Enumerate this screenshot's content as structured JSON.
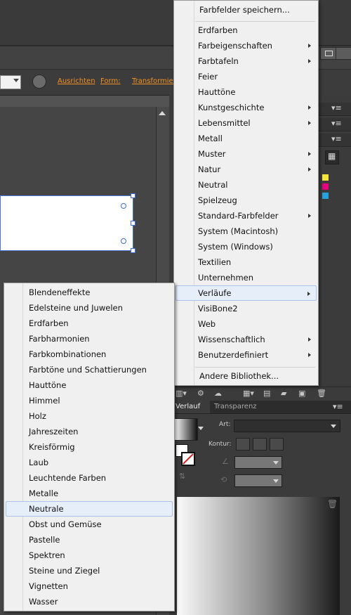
{
  "controlbar": {
    "links": [
      "Ausrichten",
      "Form:",
      "Transformieren"
    ]
  },
  "panel": {
    "tabs": {
      "active": "Verlauf",
      "other": "Transparenz"
    },
    "art_label": "Art:",
    "kontur_label": "Kontur:",
    "swatch_colors": [
      "#f5e53a",
      "#e6007e",
      "#28a0dc"
    ]
  },
  "main_menu": {
    "header_item": "Farbfelder speichern...",
    "items": [
      {
        "label": "Erdfarben",
        "submenu": false
      },
      {
        "label": "Farbeigenschaften",
        "submenu": true
      },
      {
        "label": "Farbtafeln",
        "submenu": true
      },
      {
        "label": "Feier",
        "submenu": false
      },
      {
        "label": "Hauttöne",
        "submenu": false
      },
      {
        "label": "Kunstgeschichte",
        "submenu": true
      },
      {
        "label": "Lebensmittel",
        "submenu": true
      },
      {
        "label": "Metall",
        "submenu": false
      },
      {
        "label": "Muster",
        "submenu": true
      },
      {
        "label": "Natur",
        "submenu": true
      },
      {
        "label": "Neutral",
        "submenu": false
      },
      {
        "label": "Spielzeug",
        "submenu": false
      },
      {
        "label": "Standard-Farbfelder",
        "submenu": true
      },
      {
        "label": "System (Macintosh)",
        "submenu": false
      },
      {
        "label": "System (Windows)",
        "submenu": false
      },
      {
        "label": "Textilien",
        "submenu": false
      },
      {
        "label": "Unternehmen",
        "submenu": false
      },
      {
        "label": "Verläufe",
        "submenu": true,
        "highlighted": true
      },
      {
        "label": "VisiBone2",
        "submenu": false
      },
      {
        "label": "Web",
        "submenu": false
      },
      {
        "label": "Wissenschaftlich",
        "submenu": true
      },
      {
        "label": "Benutzerdefiniert",
        "submenu": true
      }
    ],
    "footer_item": "Andere Bibliothek..."
  },
  "sub_menu": {
    "items": [
      "Blendeneffekte",
      "Edelsteine und Juwelen",
      "Erdfarben",
      "Farbharmonien",
      "Farbkombinationen",
      "Farbtöne und Schattierungen",
      "Hauttöne",
      "Himmel",
      "Holz",
      "Jahreszeiten",
      "Kreisförmig",
      "Laub",
      "Leuchtende Farben",
      "Metalle",
      "Neutrale",
      "Obst und Gemüse",
      "Pastelle",
      "Spektren",
      "Steine und Ziegel",
      "Vignetten",
      "Wasser"
    ],
    "highlighted": "Neutrale"
  }
}
